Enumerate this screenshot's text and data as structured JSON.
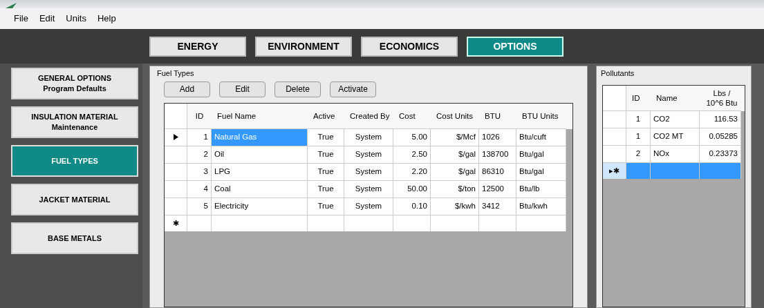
{
  "menu": [
    "File",
    "Edit",
    "Units",
    "Help"
  ],
  "tabs": [
    {
      "label": "ENERGY",
      "selected": false
    },
    {
      "label": "ENVIRONMENT",
      "selected": false
    },
    {
      "label": "ECONOMICS",
      "selected": false
    },
    {
      "label": "OPTIONS",
      "selected": true
    }
  ],
  "sidebar": [
    {
      "title": "GENERAL OPTIONS",
      "subtitle": "Program Defaults",
      "selected": false
    },
    {
      "title": "INSULATION MATERIAL",
      "subtitle": "Maintenance",
      "selected": false
    },
    {
      "title": "FUEL TYPES",
      "selected": true
    },
    {
      "title": "JACKET MATERIAL",
      "selected": false
    },
    {
      "title": "BASE METALS",
      "selected": false
    }
  ],
  "fuel_types": {
    "title": "Fuel Types",
    "buttons": [
      "Add",
      "Edit",
      "Delete",
      "Activate"
    ],
    "columns": [
      "ID",
      "Fuel Name",
      "Active",
      "Created By",
      "Cost",
      "Cost Units",
      "BTU",
      "BTU Units"
    ],
    "rows": [
      {
        "cells": [
          "1",
          "Natural Gas",
          "True",
          "System",
          "5.00",
          "$/Mcf",
          "1026",
          "Btu/cuft"
        ],
        "selected": true
      },
      {
        "cells": [
          "2",
          "Oil",
          "True",
          "System",
          "2.50",
          "$/gal",
          "138700",
          "Btu/gal"
        ],
        "selected": false
      },
      {
        "cells": [
          "3",
          "LPG",
          "True",
          "System",
          "2.20",
          "$/gal",
          "86310",
          "Btu/gal"
        ],
        "selected": false
      },
      {
        "cells": [
          "4",
          "Coal",
          "True",
          "System",
          "50.00",
          "$/ton",
          "12500",
          "Btu/lb"
        ],
        "selected": false
      },
      {
        "cells": [
          "5",
          "Electricity",
          "True",
          "System",
          "0.10",
          "$/kwh",
          "3412",
          "Btu/kwh"
        ],
        "selected": false
      }
    ],
    "new_row": {
      "marker": "✱",
      "selected": false
    }
  },
  "pollutants": {
    "title": "Pollutants",
    "columns": [
      "ID",
      "Name",
      "Lbs / 10^6 Btu"
    ],
    "rows": [
      {
        "cells": [
          "1",
          "CO2",
          "116.53"
        ],
        "selected": false
      },
      {
        "cells": [
          "1",
          "CO2 MT",
          "0.05285"
        ],
        "selected": false
      },
      {
        "cells": [
          "2",
          "NOx",
          "0.23373"
        ],
        "selected": false
      }
    ],
    "new_row": {
      "marker": "▸✱",
      "selected": true
    }
  }
}
